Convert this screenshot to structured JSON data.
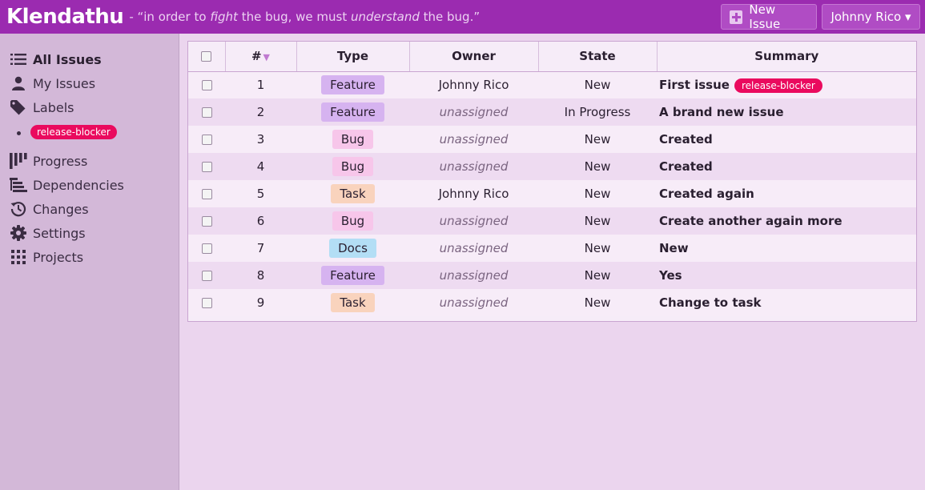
{
  "header": {
    "logo": "Klendathu",
    "tagline_parts": [
      "- “in order to ",
      "fight",
      " the bug, we must ",
      "understand",
      " the bug.”"
    ],
    "new_issue_label": "New Issue",
    "user_label": "Johnny Rico ▾"
  },
  "sidebar": {
    "items": [
      {
        "label": "All Issues",
        "icon": "list-icon"
      },
      {
        "label": "My Issues",
        "icon": "person-icon"
      },
      {
        "label": "Labels",
        "icon": "tag-icon"
      },
      {
        "label": "Progress",
        "icon": "kanban-icon"
      },
      {
        "label": "Dependencies",
        "icon": "dependencies-icon"
      },
      {
        "label": "Changes",
        "icon": "history-icon"
      },
      {
        "label": "Settings",
        "icon": "gear-icon"
      },
      {
        "label": "Projects",
        "icon": "grid-icon"
      }
    ],
    "label_item": "release-blocker"
  },
  "table": {
    "headers": {
      "num": "#",
      "type": "Type",
      "owner": "Owner",
      "state": "State",
      "summary": "Summary"
    },
    "sort_indicator": "▼",
    "rows": [
      {
        "id": "1",
        "type": "Feature",
        "owner": "Johnny Rico",
        "state": "New",
        "summary": "First issue",
        "label": "release-blocker"
      },
      {
        "id": "2",
        "type": "Feature",
        "owner": "unassigned",
        "state": "In Progress",
        "summary": "A brand new issue"
      },
      {
        "id": "3",
        "type": "Bug",
        "owner": "unassigned",
        "state": "New",
        "summary": "Created"
      },
      {
        "id": "4",
        "type": "Bug",
        "owner": "unassigned",
        "state": "New",
        "summary": "Created"
      },
      {
        "id": "5",
        "type": "Task",
        "owner": "Johnny Rico",
        "state": "New",
        "summary": "Created again"
      },
      {
        "id": "6",
        "type": "Bug",
        "owner": "unassigned",
        "state": "New",
        "summary": "Create another again more"
      },
      {
        "id": "7",
        "type": "Docs",
        "owner": "unassigned",
        "state": "New",
        "summary": "New"
      },
      {
        "id": "8",
        "type": "Feature",
        "owner": "unassigned",
        "state": "New",
        "summary": "Yes"
      },
      {
        "id": "9",
        "type": "Task",
        "owner": "unassigned",
        "state": "New",
        "summary": "Change to task"
      }
    ]
  },
  "colors": {
    "header_bg": "#9b2bb0",
    "label_pink": "#ea0a5e",
    "type_feature": "#d6b3f0",
    "type_bug": "#f7c6ea",
    "type_task": "#f9d3bd",
    "type_docs": "#b3def5"
  }
}
